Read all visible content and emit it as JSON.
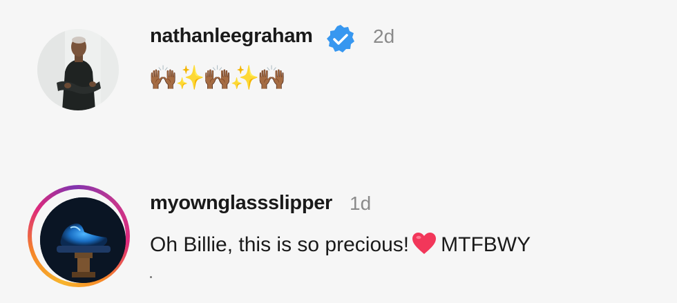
{
  "comments": [
    {
      "username": "nathanleegraham",
      "verified": true,
      "time": "2d",
      "text": "🙌🏾✨🙌🏾✨🙌🏾",
      "avatar_icon": "profile-photo-person-in-black-outfit"
    },
    {
      "username": "myownglassslipper",
      "verified": false,
      "time": "1d",
      "text_before": "Oh Billie, this is so precious!",
      "heart": "❤️",
      "text_after": "MTFBWY",
      "avatar_icon": "profile-photo-glass-slipper",
      "story_ring": true
    }
  ],
  "colors": {
    "verified_blue": "#3797f0",
    "heart_red": "#f2375a",
    "timestamp_gray": "#8a8a8a",
    "username_black": "#1a1a1a",
    "background": "#f6f6f6"
  }
}
